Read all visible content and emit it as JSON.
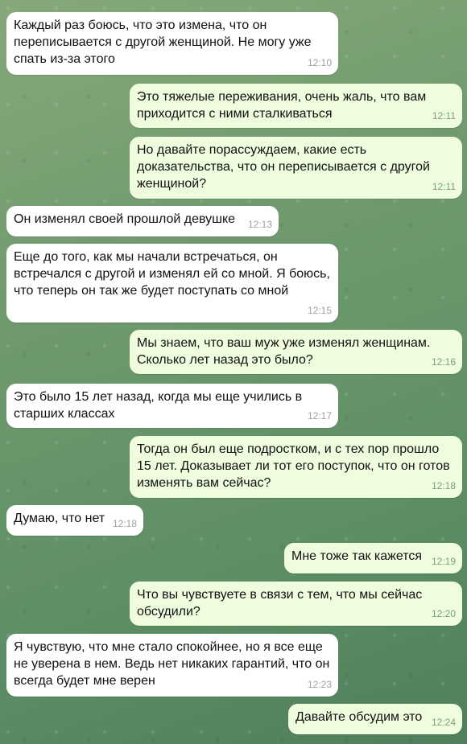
{
  "messages": [
    {
      "side": "in",
      "text": "Каждый раз боюсь, что это измена, что он переписывается с другой женщиной. Не могу уже спать из-за этого",
      "time": "12:10"
    },
    {
      "side": "out",
      "text": "Это тяжелые переживания, очень жаль, что вам приходится с ними сталкиваться",
      "time": "12:11"
    },
    {
      "side": "out",
      "text": "Но давайте порассуждаем, какие есть доказательства, что он переписывается с другой женщиной?",
      "time": "12:11"
    },
    {
      "side": "in",
      "text": "Он изменял своей прошлой девушке",
      "time": "12:13"
    },
    {
      "side": "in",
      "text": "Еще до того, как мы начали встречаться, он встречался с другой и изменял ей со мной. Я боюсь, что теперь он так же будет поступать со мной",
      "time": "12:15"
    },
    {
      "side": "out",
      "text": "Мы знаем, что ваш муж уже изменял женщинам. Сколько лет назад это было?",
      "time": "12:16"
    },
    {
      "side": "in",
      "text": "Это было 15 лет назад, когда мы еще учились в старших классах",
      "time": "12:17"
    },
    {
      "side": "out",
      "text": "Тогда он был еще подростком, и с тех пор прошло 15 лет. Доказывает ли тот его поступок, что он готов изменять вам сейчас?",
      "time": "12:18"
    },
    {
      "side": "in",
      "text": "Думаю, что нет",
      "time": "12:18"
    },
    {
      "side": "out",
      "text": "Мне тоже так кажется",
      "time": "12:19"
    },
    {
      "side": "out",
      "text": "Что вы чувствуете в связи с тем, что мы сейчас обсудили?",
      "time": "12:20"
    },
    {
      "side": "in",
      "text": "Я чувствую, что мне стало спокойнее, но я все еще не уверена в нем. Ведь нет никаких гарантий, что он всегда будет мне верен",
      "time": "12:23"
    },
    {
      "side": "out",
      "text": "Давайте обсудим это",
      "time": "12:24"
    }
  ]
}
